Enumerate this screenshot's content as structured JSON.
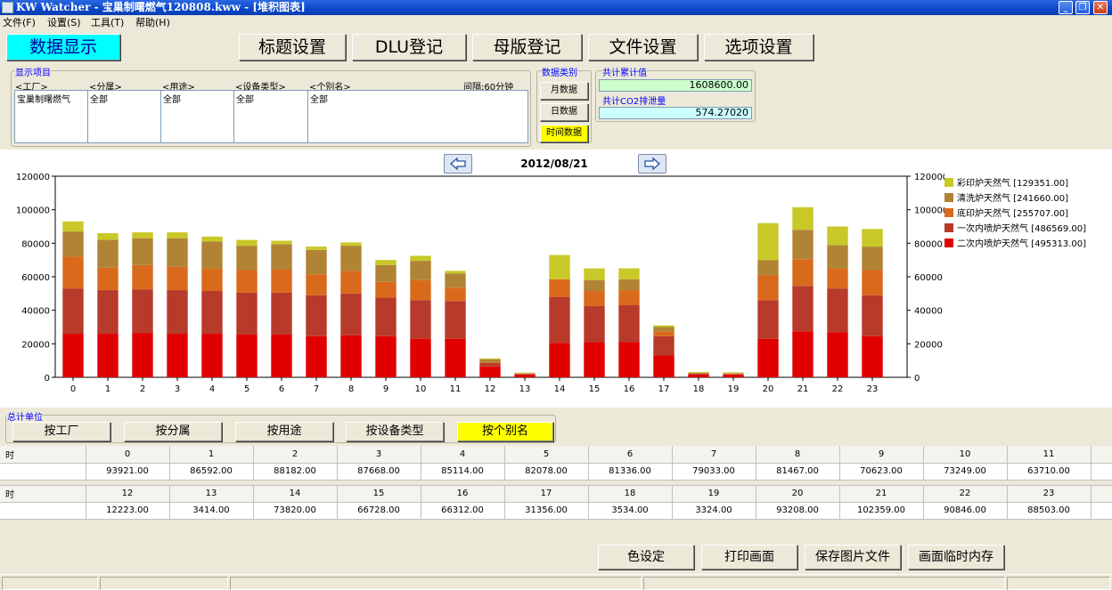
{
  "window": {
    "title": "KW Watcher - 宝巢制曙燃气120808.kww - [堆积图表]"
  },
  "menu": [
    {
      "label": "文件(F)",
      "name": "file"
    },
    {
      "label": "设置(S)",
      "name": "settings"
    },
    {
      "label": "工具(T)",
      "name": "tools"
    },
    {
      "label": "帮助(H)",
      "name": "help"
    }
  ],
  "tabs": [
    {
      "label": "数据显示",
      "name": "data-display"
    },
    {
      "label": "标题设置",
      "name": "title-settings"
    },
    {
      "label": "DLU登记",
      "name": "dlu-register"
    },
    {
      "label": "母版登记",
      "name": "master-register"
    },
    {
      "label": "文件设置",
      "name": "file-settings"
    },
    {
      "label": "选项设置",
      "name": "option-settings"
    }
  ],
  "display_items": {
    "label": "显示项目",
    "interval": "间隔:60分钟",
    "columns": [
      {
        "header": "<工厂>",
        "value": "宝巢制曙燃气",
        "name": "factory"
      },
      {
        "header": "<分属>",
        "value": "全部",
        "name": "division"
      },
      {
        "header": "<用途>",
        "value": "全部",
        "name": "purpose"
      },
      {
        "header": "<设备类型>",
        "value": "全部",
        "name": "device-type"
      },
      {
        "header": "<个别名>",
        "value": "全部",
        "name": "individual-name"
      }
    ]
  },
  "data_category": {
    "label": "数据类别",
    "monthly": "月数据",
    "daily": "日数据",
    "time": "时间数据"
  },
  "totals": {
    "cumulative_label": "共计累计值",
    "cumulative_value": "1608600.00",
    "cumulative_color": "#ccffcc",
    "co2_label": "共计CO2排泄量",
    "co2_value": "574.27020",
    "co2_color": "#ccffff"
  },
  "chart_nav": {
    "date": "2012/08/21"
  },
  "chart_data": {
    "type": "bar",
    "stacked": true,
    "categories": [
      "0",
      "1",
      "2",
      "3",
      "4",
      "5",
      "6",
      "7",
      "8",
      "9",
      "10",
      "11",
      "12",
      "13",
      "14",
      "15",
      "16",
      "17",
      "18",
      "19",
      "20",
      "21",
      "22",
      "23"
    ],
    "ylim": [
      0,
      120000
    ],
    "yticks": [
      "0",
      "20000",
      "40000",
      "60000",
      "80000",
      "100000",
      "120000"
    ],
    "ytick_values": [
      0,
      20000,
      40000,
      60000,
      80000,
      100000,
      120000
    ],
    "dual_axis": true,
    "grid": false,
    "legend_position": "right",
    "series": [
      {
        "name": "二次内喷炉天然气 [495313.00]",
        "color": "#e00000",
        "values": [
          26000,
          26000,
          26500,
          26000,
          26000,
          25500,
          25500,
          24500,
          25000,
          24500,
          23000,
          23000,
          6500,
          1700,
          20500,
          21000,
          21000,
          13000,
          1700,
          1700,
          23000,
          27500,
          27000,
          24500
        ]
      },
      {
        "name": "一次内喷炉天然气 [486569.00]",
        "color": "#b83a2a",
        "values": [
          27000,
          26000,
          26000,
          26000,
          25500,
          25000,
          25000,
          24500,
          25000,
          23000,
          23000,
          22500,
          2000,
          300,
          27500,
          21500,
          22000,
          11500,
          500,
          300,
          23000,
          27000,
          26000,
          24500
        ]
      },
      {
        "name": "底印炉天然气 [255707.00]",
        "color": "#d96a1c",
        "values": [
          19000,
          13500,
          14500,
          14000,
          13500,
          13500,
          14000,
          12500,
          13500,
          9500,
          12000,
          8000,
          300,
          200,
          10500,
          9000,
          9000,
          3000,
          200,
          200,
          15000,
          16000,
          12000,
          15000
        ]
      },
      {
        "name": "清洗炉天然气 [241660.00]",
        "color": "#b08434",
        "values": [
          15000,
          16500,
          16000,
          17000,
          16000,
          14500,
          15000,
          14500,
          15000,
          10000,
          11500,
          8500,
          2000,
          300,
          0,
          6500,
          6500,
          2500,
          300,
          300,
          9000,
          17500,
          14000,
          14000
        ]
      },
      {
        "name": "彩印炉天然气 [129351.00]",
        "color": "#c8c828",
        "values": [
          6000,
          4000,
          3500,
          3500,
          3000,
          3500,
          2000,
          2000,
          2000,
          3000,
          3000,
          1500,
          500,
          300,
          14500,
          7000,
          6500,
          1000,
          500,
          500,
          22000,
          13500,
          11000,
          10500
        ]
      }
    ]
  },
  "aggregate_units": {
    "label": "总计单位",
    "by_factory": "按工厂",
    "by_division": "按分属",
    "by_purpose": "按用途",
    "by_device_type": "按设备类型",
    "by_alias": "按个别名"
  },
  "table": {
    "row_label": "时",
    "rows": [
      {
        "hours": [
          "0",
          "1",
          "2",
          "3",
          "4",
          "5",
          "6",
          "7",
          "8",
          "9",
          "10",
          "11"
        ],
        "values": [
          "93921.00",
          "86592.00",
          "88182.00",
          "87668.00",
          "85114.00",
          "82078.00",
          "81336.00",
          "79033.00",
          "81467.00",
          "70623.00",
          "73249.00",
          "63710.00"
        ]
      },
      {
        "hours": [
          "12",
          "13",
          "14",
          "15",
          "16",
          "17",
          "18",
          "19",
          "20",
          "21",
          "22",
          "23"
        ],
        "values": [
          "12223.00",
          "3414.00",
          "73820.00",
          "66728.00",
          "66312.00",
          "31356.00",
          "3534.00",
          "3324.00",
          "93208.00",
          "102359.00",
          "90846.00",
          "88503.00"
        ]
      }
    ]
  },
  "actions": {
    "color_settings": "色设定",
    "print_screen": "打印画面",
    "save_image": "保存图片文件",
    "screen_memory": "画面临时内存"
  }
}
